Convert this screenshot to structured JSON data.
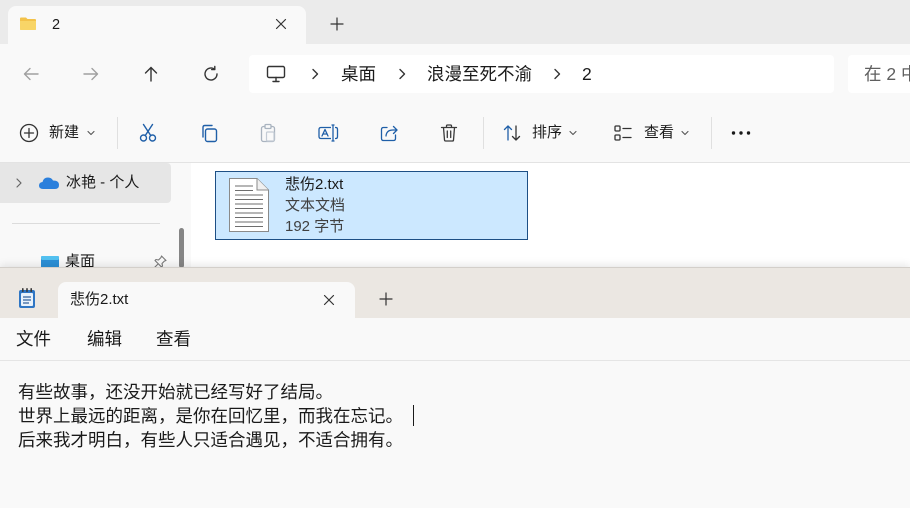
{
  "colors": {
    "accent": "#1f5fa8",
    "selection_bg": "#cce8ff",
    "selection_border": "#1d4f85",
    "folder": "#f3c24a",
    "folder_front": "#f8d567",
    "onedrive": "#2a7fdc",
    "notepad_icon": "#2f76c4"
  },
  "explorer": {
    "tab": {
      "title": "2",
      "icon": "folder-icon"
    },
    "nav": {
      "icons": [
        "back-arrow-icon",
        "forward-arrow-icon",
        "up-arrow-icon",
        "refresh-icon"
      ],
      "back_enabled": false,
      "forward_enabled": false
    },
    "address": {
      "root_icon": "computer-icon",
      "crumbs": [
        "桌面",
        "浪漫至死不渝",
        "2"
      ]
    },
    "search": {
      "placeholder": "在 2 中"
    },
    "toolbar": {
      "new_label": "新建",
      "sort_label": "排序",
      "view_label": "查看",
      "icons": [
        "cut-icon",
        "copy-icon",
        "paste-icon",
        "rename-icon",
        "share-icon",
        "delete-icon",
        "more-icon"
      ],
      "paste_enabled": false
    },
    "sidebar": {
      "items": [
        {
          "label": "冰艳 - 个人",
          "icon": "onedrive-cloud-icon",
          "selected": true
        },
        {
          "label": "桌面",
          "icon": "desktop-icon",
          "pinned": true
        }
      ]
    },
    "file": {
      "name": "悲伤2.txt",
      "type": "文本文档",
      "size": "192 字节",
      "icon": "text-file-icon",
      "selected": true
    }
  },
  "notepad": {
    "tab": {
      "title": "悲伤2.txt",
      "icon": "notepad-icon"
    },
    "menu": [
      "文件",
      "编辑",
      "查看"
    ],
    "lines": [
      "有些故事，还没开始就已经写好了结局。",
      "世界上最远的距离，是你在回忆里，而我在忘记。",
      "后来我才明白，有些人只适合遇见，不适合拥有。"
    ]
  }
}
